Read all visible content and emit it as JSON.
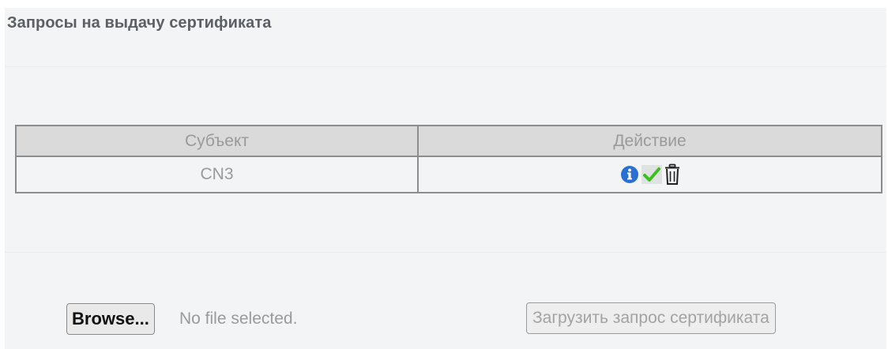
{
  "page": {
    "title": "Запросы на выдачу сертификата"
  },
  "table": {
    "headers": {
      "subject": "Субъект",
      "action": "Действие"
    },
    "rows": [
      {
        "subject": "CN3",
        "actions": [
          "info-icon",
          "check-icon",
          "trash-icon"
        ]
      }
    ]
  },
  "upload": {
    "browse_label": "Browse...",
    "file_status": "No file selected.",
    "upload_label": "Загрузить запрос сертификата"
  },
  "colors": {
    "info_icon": "#2a6fd6",
    "check_icon": "#3fbf1f",
    "trash_icon": "#222222",
    "header_bg": "#dadada",
    "panel_bg": "#f2f4f5"
  }
}
